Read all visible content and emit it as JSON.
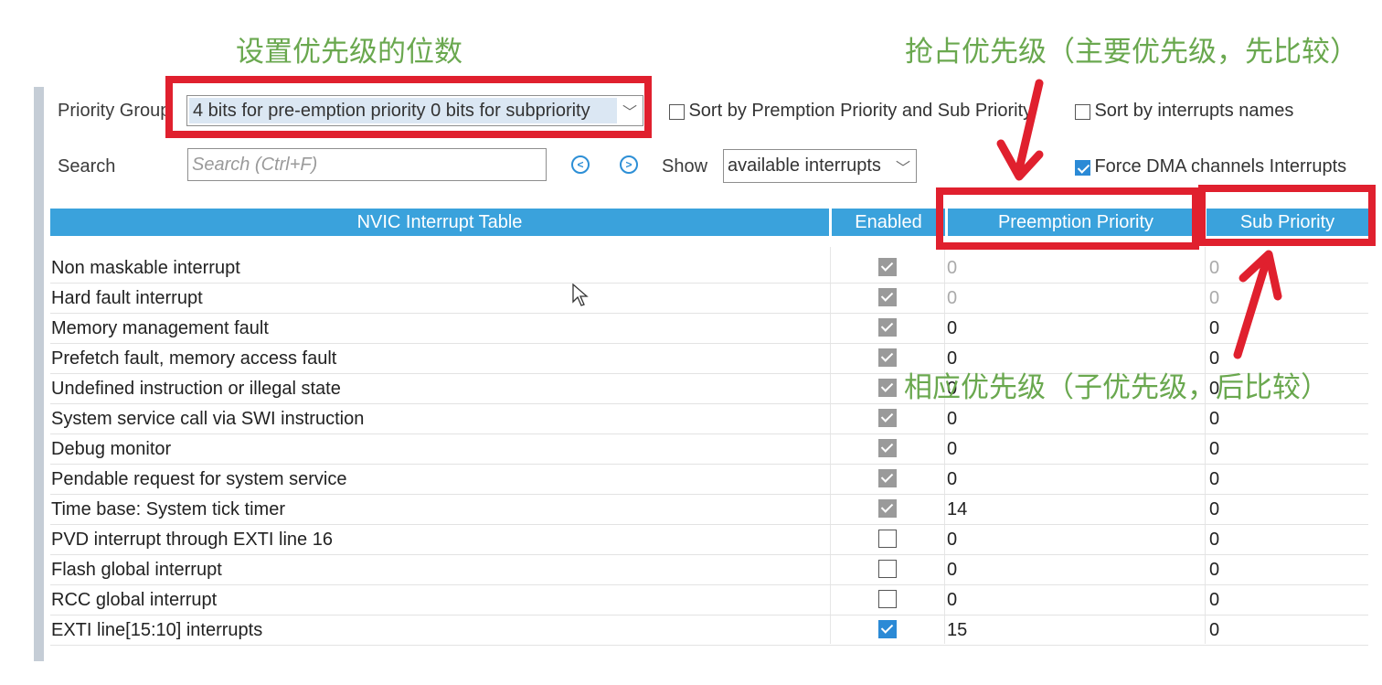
{
  "annotations": {
    "top_left": "设置优先级的位数",
    "top_right": "抢占优先级（主要优先级，先比较）",
    "middle": "相应优先级（子优先级，后比较）"
  },
  "toolbar": {
    "priority_group_label": "Priority Group",
    "priority_group_value": "4 bits for pre-emption priority 0 bits for subpriority",
    "sort_premption_label": "Sort by Premption Priority and Sub Priority",
    "sort_names_label": "Sort by interrupts names",
    "search_label": "Search",
    "search_placeholder": "Search (Ctrl+F)",
    "show_label": "Show",
    "show_value": "available interrupts",
    "force_dma_label": "Force DMA channels Interrupts"
  },
  "table": {
    "headers": {
      "name": "NVIC Interrupt Table",
      "enabled": "Enabled",
      "preemption": "Preemption Priority",
      "sub": "Sub Priority"
    },
    "rows": [
      {
        "name": "Non maskable interrupt",
        "enabled": "locked",
        "pre": "0",
        "sub": "0",
        "muted": true
      },
      {
        "name": "Hard fault interrupt",
        "enabled": "locked",
        "pre": "0",
        "sub": "0",
        "muted": true
      },
      {
        "name": "Memory management fault",
        "enabled": "locked",
        "pre": "0",
        "sub": "0"
      },
      {
        "name": "Prefetch fault, memory access fault",
        "enabled": "locked",
        "pre": "0",
        "sub": "0"
      },
      {
        "name": "Undefined instruction or illegal state",
        "enabled": "locked",
        "pre": "0",
        "sub": "0"
      },
      {
        "name": "System service call via SWI instruction",
        "enabled": "locked",
        "pre": "0",
        "sub": "0"
      },
      {
        "name": "Debug monitor",
        "enabled": "locked",
        "pre": "0",
        "sub": "0"
      },
      {
        "name": "Pendable request for system service",
        "enabled": "locked",
        "pre": "0",
        "sub": "0"
      },
      {
        "name": "Time base: System tick timer",
        "enabled": "locked",
        "pre": "14",
        "sub": "0"
      },
      {
        "name": "PVD interrupt through EXTI line 16",
        "enabled": "off",
        "pre": "0",
        "sub": "0"
      },
      {
        "name": "Flash global interrupt",
        "enabled": "off",
        "pre": "0",
        "sub": "0"
      },
      {
        "name": "RCC global interrupt",
        "enabled": "off",
        "pre": "0",
        "sub": "0"
      },
      {
        "name": "EXTI line[15:10] interrupts",
        "enabled": "on",
        "pre": "15",
        "sub": "0"
      }
    ]
  },
  "colors": {
    "header_blue": "#3aa2dc",
    "annotation_green": "#6aa84f",
    "highlight_red": "#e0202e",
    "checkbox_blue": "#2b8ad6"
  }
}
